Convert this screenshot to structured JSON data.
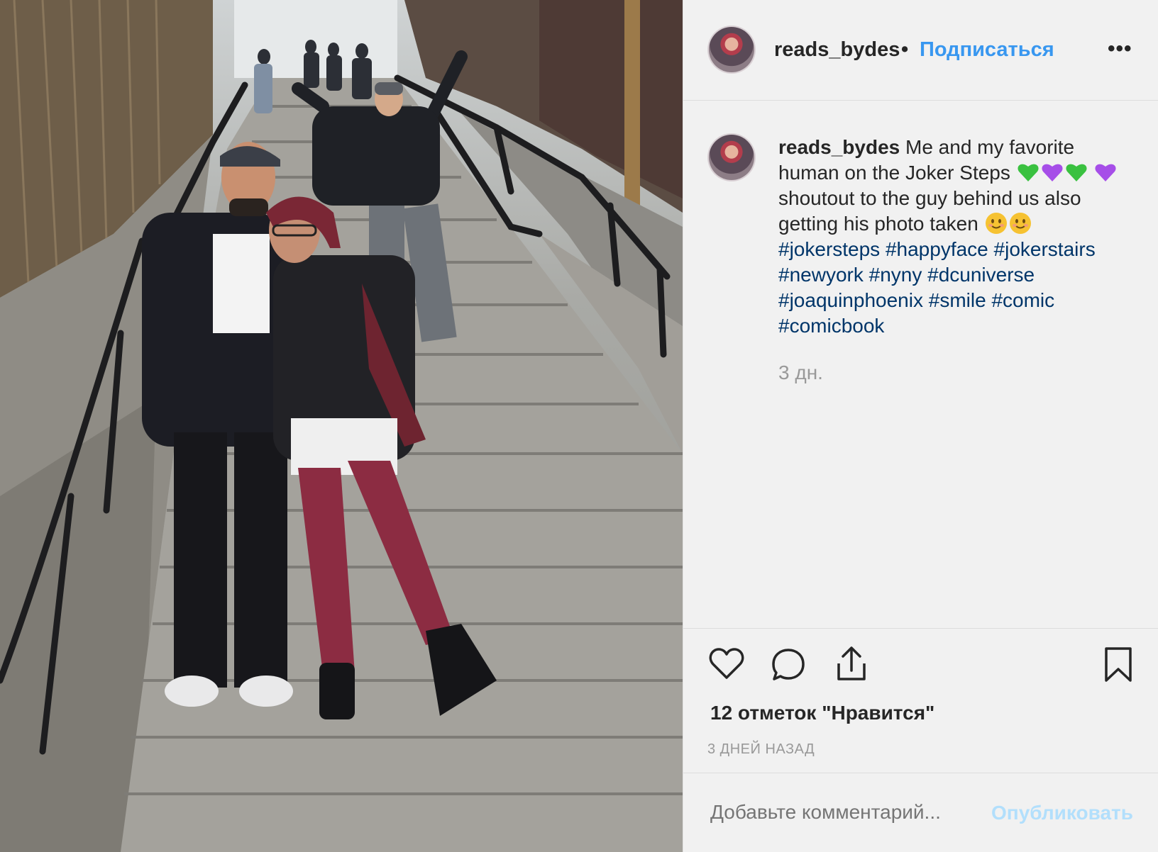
{
  "post": {
    "username": "reads_bydes",
    "separator": "•",
    "follow_label": "Подписаться",
    "more_label": "•••",
    "photo_alt": "post-photo"
  },
  "caption": {
    "username": "reads_bydes",
    "text_1": "Me and my favorite human on the Joker Steps",
    "text_2": "shoutout to the guy behind us also getting his photo taken",
    "hashtags": [
      "#jokersteps",
      "#happyface",
      "#jokerstairs",
      "#newyork",
      "#nyny",
      "#dcuniverse",
      "#joaquinphoenix",
      "#smile",
      "#comic",
      "#comicbook"
    ],
    "time": "3 дн."
  },
  "actions": {
    "like_icon": "heart-icon",
    "comment_icon": "comment-icon",
    "share_icon": "share-icon",
    "save_icon": "bookmark-icon",
    "likes_text": "12 отметок \"Нравится\"",
    "posted_ago": "3 ДНЕЙ НАЗАД"
  },
  "comment": {
    "placeholder": "Добавьте комментарий...",
    "publish_label": "Опубликовать"
  },
  "colors": {
    "link_blue": "#3897f0",
    "hashtag": "#003569",
    "muted": "#999999",
    "publish_disabled": "#b2dffc",
    "green_heart": "#3ac140",
    "purple_heart": "#a64ee8"
  }
}
